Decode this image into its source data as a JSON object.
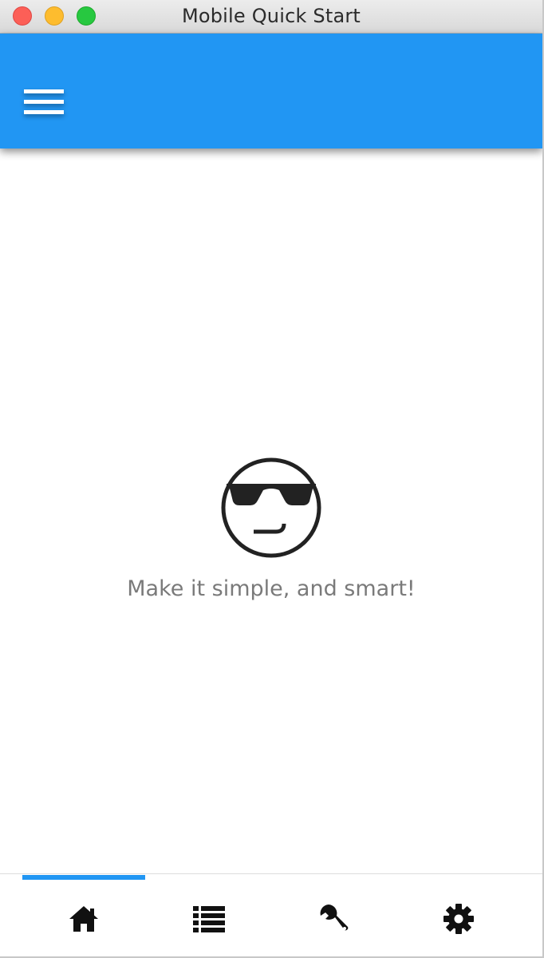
{
  "window": {
    "title": "Mobile Quick Start",
    "controls": [
      "close",
      "minimize",
      "zoom"
    ]
  },
  "appbar": {
    "color": "#2196f3",
    "menu_icon": "hamburger-menu-icon"
  },
  "content": {
    "hero_icon": "sunglasses-smirk-face-icon",
    "message": "Make it simple, and smart!"
  },
  "tabs": [
    {
      "icon": "home-icon",
      "selected": true
    },
    {
      "icon": "list-icon",
      "selected": false
    },
    {
      "icon": "wrench-icon",
      "selected": false
    },
    {
      "icon": "gear-icon",
      "selected": false
    }
  ],
  "colors": {
    "accent": "#2196f3",
    "text_muted": "#7a7a7a",
    "icon": "#111111"
  }
}
